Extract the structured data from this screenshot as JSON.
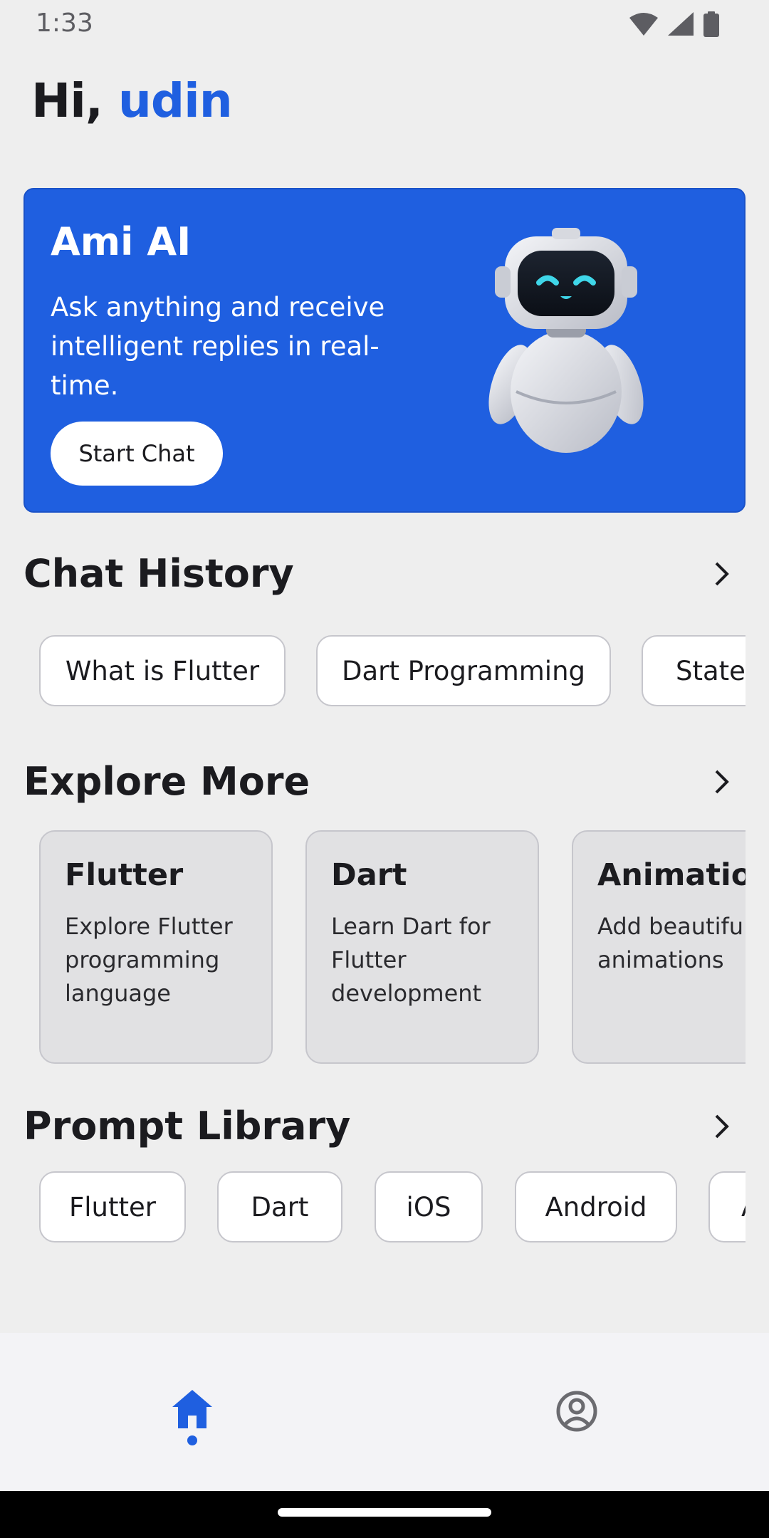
{
  "status_bar": {
    "time": "1:33",
    "icons": [
      "wifi-icon",
      "signal-icon",
      "battery-icon"
    ]
  },
  "greeting": {
    "prefix": "Hi, ",
    "name": "udin"
  },
  "hero": {
    "title": "Ami AI",
    "description": "Ask anything and receive intelligent replies in real-time.",
    "button_label": "Start Chat",
    "image": "robot-illustration"
  },
  "chat_history": {
    "title": "Chat History",
    "items": [
      "What is Flutter",
      "Dart Programming",
      "State"
    ]
  },
  "explore_more": {
    "title": "Explore More",
    "cards": [
      {
        "title": "Flutter",
        "description": "Explore Flutter programming language"
      },
      {
        "title": "Dart",
        "description": "Learn Dart for Flutter development"
      },
      {
        "title": "Animation",
        "description": "Add beautiful animations"
      }
    ]
  },
  "prompt_library": {
    "title": "Prompt Library",
    "items": [
      "Flutter",
      "Dart",
      "iOS",
      "Android",
      "A"
    ]
  },
  "bottom_nav": {
    "items": [
      "home-icon",
      "profile-icon"
    ],
    "active": "home-icon"
  },
  "colors": {
    "accent": "#1f5fe0",
    "background": "#eeeeee",
    "card": "#e1e1e3"
  }
}
